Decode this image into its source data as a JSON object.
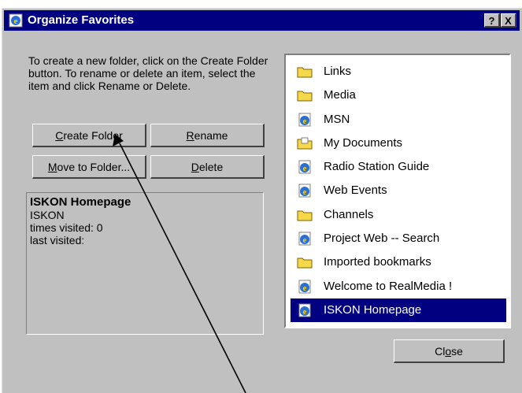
{
  "window": {
    "title": "Organize Favorites",
    "help_button": "?",
    "close_button": "X"
  },
  "instructions": "To create a new folder, click on the Create Folder button. To rename or delete an item, select the item and click Rename or Delete.",
  "buttons": {
    "create_folder": {
      "accel": "C",
      "rest": "reate Folder"
    },
    "rename": {
      "accel": "R",
      "rest": "ename"
    },
    "move_to_folder": {
      "accel": "M",
      "rest": "ove to Folder..."
    },
    "delete": {
      "accel": "D",
      "rest": "elete"
    },
    "close": {
      "pre": "Cl",
      "accel": "o",
      "rest": "se"
    }
  },
  "info": {
    "name": "ISKON Homepage",
    "url": "ISKON",
    "visited": "times visited: 0",
    "last": "last visited:"
  },
  "favorites": [
    {
      "label": "Links",
      "icon": "folder-icon"
    },
    {
      "label": "Media",
      "icon": "folder-icon"
    },
    {
      "label": "MSN",
      "icon": "ie-page-icon"
    },
    {
      "label": "My Documents",
      "icon": "my-documents-folder-icon"
    },
    {
      "label": "Radio Station Guide",
      "icon": "ie-page-icon"
    },
    {
      "label": "Web Events",
      "icon": "ie-page-icon"
    },
    {
      "label": "Channels",
      "icon": "folder-icon"
    },
    {
      "label": "Project Web -- Search",
      "icon": "ie-page-icon"
    },
    {
      "label": "Imported bookmarks",
      "icon": "folder-icon"
    },
    {
      "label": "Welcome to RealMedia !",
      "icon": "ie-page-icon"
    },
    {
      "label": "ISKON Homepage",
      "icon": "ie-page-icon",
      "selected": true
    }
  ],
  "colors": {
    "titlebar": "#000080",
    "face": "#c0c0c0",
    "selection": "#000080",
    "folder": "#f5d94b"
  }
}
